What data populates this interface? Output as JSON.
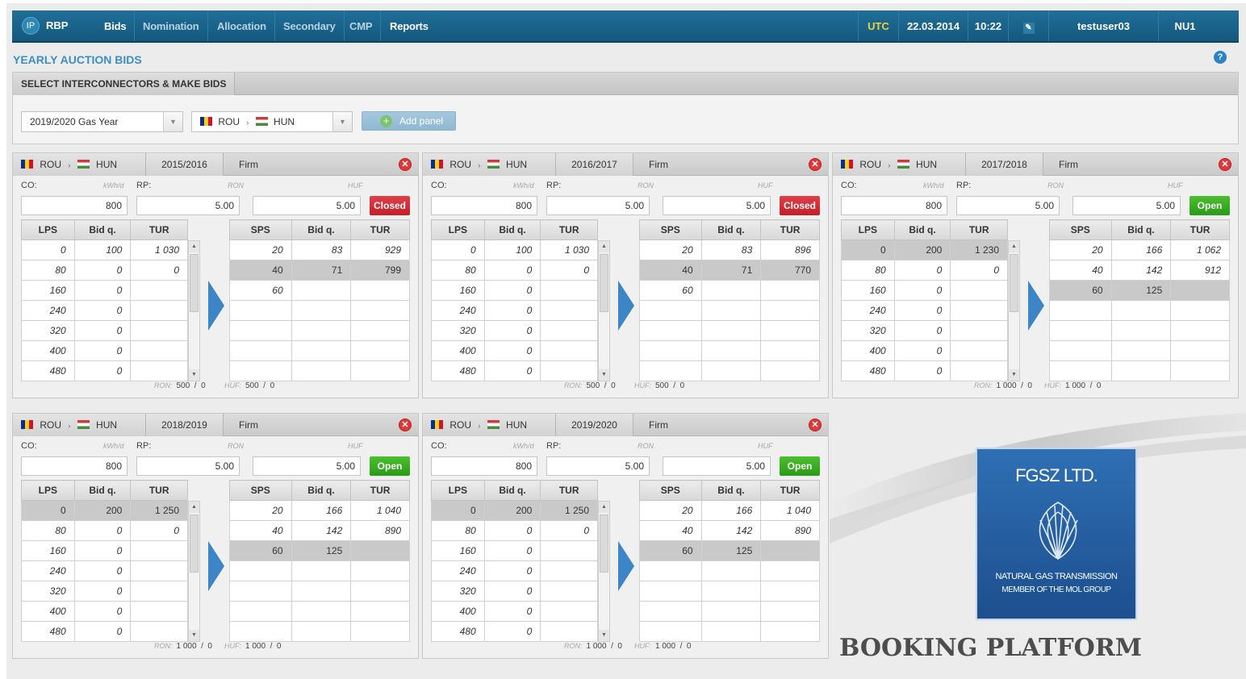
{
  "topbar": {
    "ip": "IP",
    "app": "RBP",
    "nav": [
      "Bids",
      "Nomination",
      "Allocation",
      "Secondary",
      "CMP",
      "Reports"
    ],
    "utc": "UTC",
    "date": "22.03.2014",
    "time": "10:22",
    "user": "testuser03",
    "role": "NU1"
  },
  "page": {
    "title": "YEARLY AUCTION BIDS",
    "help": "?"
  },
  "select": {
    "header": "SELECT INTERCONNECTORS & MAKE BIDS",
    "year": "2019/2020 Gas Year",
    "from": "ROU",
    "to": "HUN",
    "add": "Add panel"
  },
  "panels": [
    {
      "from": "ROU",
      "to": "HUN",
      "year": "2015/2016",
      "type": "Firm",
      "co_label": "CO:",
      "co_unit": "kWh/d",
      "rp_label": "RP:",
      "rp_unit": "RON",
      "huf_unit": "HUF",
      "co": "800",
      "rp": "5.00",
      "huf": "5.00",
      "status": "Closed",
      "lps_head": [
        "LPS",
        "Bid q.",
        "TUR"
      ],
      "lps": [
        [
          "0",
          "100",
          "1 030"
        ],
        [
          "80",
          "0",
          "0"
        ],
        [
          "160",
          "0",
          ""
        ],
        [
          "240",
          "0",
          ""
        ],
        [
          "320",
          "0",
          ""
        ],
        [
          "400",
          "0",
          ""
        ],
        [
          "480",
          "0",
          ""
        ]
      ],
      "sps_head": [
        "SPS",
        "Bid q.",
        "TUR"
      ],
      "sps": [
        [
          "20",
          "83",
          "929"
        ],
        [
          "40",
          "71",
          "799"
        ],
        [
          "60",
          "",
          ""
        ],
        [
          "",
          "",
          ""
        ],
        [
          "",
          "",
          ""
        ],
        [
          "",
          "",
          ""
        ],
        [
          "",
          "",
          ""
        ]
      ],
      "ron_label": "RON:",
      "ron": "500  /  0",
      "hufl": "HUF:",
      "huf_total": "500  /  0"
    },
    {
      "from": "ROU",
      "to": "HUN",
      "year": "2016/2017",
      "type": "Firm",
      "co_label": "CO:",
      "co_unit": "kWh/d",
      "rp_label": "RP:",
      "rp_unit": "RON",
      "huf_unit": "HUF",
      "co": "800",
      "rp": "5.00",
      "huf": "5.00",
      "status": "Closed",
      "lps_head": [
        "LPS",
        "Bid q.",
        "TUR"
      ],
      "lps": [
        [
          "0",
          "100",
          "1 030"
        ],
        [
          "80",
          "0",
          "0"
        ],
        [
          "160",
          "0",
          ""
        ],
        [
          "240",
          "0",
          ""
        ],
        [
          "320",
          "0",
          ""
        ],
        [
          "400",
          "0",
          ""
        ],
        [
          "480",
          "0",
          ""
        ]
      ],
      "sps_head": [
        "SPS",
        "Bid q.",
        "TUR"
      ],
      "sps": [
        [
          "20",
          "83",
          "896"
        ],
        [
          "40",
          "71",
          "770"
        ],
        [
          "60",
          "",
          ""
        ],
        [
          "",
          "",
          ""
        ],
        [
          "",
          "",
          ""
        ],
        [
          "",
          "",
          ""
        ],
        [
          "",
          "",
          ""
        ]
      ],
      "ron_label": "RON:",
      "ron": "500  /  0",
      "hufl": "HUF:",
      "huf_total": "500  /  0"
    },
    {
      "from": "ROU",
      "to": "HUN",
      "year": "2017/2018",
      "type": "Firm",
      "co_label": "CO:",
      "co_unit": "kWh/d",
      "rp_label": "RP:",
      "rp_unit": "RON",
      "huf_unit": "HUF",
      "co": "800",
      "rp": "5.00",
      "huf": "5.00",
      "status": "Open",
      "lps_head": [
        "LPS",
        "Bid q.",
        "TUR"
      ],
      "lps": [
        [
          "0",
          "200",
          "1 230"
        ],
        [
          "80",
          "0",
          "0"
        ],
        [
          "160",
          "0",
          ""
        ],
        [
          "240",
          "0",
          ""
        ],
        [
          "320",
          "0",
          ""
        ],
        [
          "400",
          "0",
          ""
        ],
        [
          "480",
          "0",
          ""
        ]
      ],
      "sps_head": [
        "SPS",
        "Bid q.",
        "TUR"
      ],
      "sps": [
        [
          "20",
          "166",
          "1 062"
        ],
        [
          "40",
          "142",
          "912"
        ],
        [
          "60",
          "125",
          ""
        ],
        [
          "",
          "",
          ""
        ],
        [
          "",
          "",
          ""
        ],
        [
          "",
          "",
          ""
        ],
        [
          "",
          "",
          ""
        ]
      ],
      "ron_label": "RON:",
      "ron": "1 000  /  0",
      "hufl": "HUF:",
      "huf_total": "1 000  /  0"
    },
    {
      "from": "ROU",
      "to": "HUN",
      "year": "2018/2019",
      "type": "Firm",
      "co_label": "CO:",
      "co_unit": "kWh/d",
      "rp_label": "RP:",
      "rp_unit": "RON",
      "huf_unit": "HUF",
      "co": "800",
      "rp": "5.00",
      "huf": "5.00",
      "status": "Open",
      "lps_head": [
        "LPS",
        "Bid q.",
        "TUR"
      ],
      "lps": [
        [
          "0",
          "200",
          "1 250"
        ],
        [
          "80",
          "0",
          "0"
        ],
        [
          "160",
          "0",
          ""
        ],
        [
          "240",
          "0",
          ""
        ],
        [
          "320",
          "0",
          ""
        ],
        [
          "400",
          "0",
          ""
        ],
        [
          "480",
          "0",
          ""
        ]
      ],
      "sps_head": [
        "SPS",
        "Bid q.",
        "TUR"
      ],
      "sps": [
        [
          "20",
          "166",
          "1 040"
        ],
        [
          "40",
          "142",
          "890"
        ],
        [
          "60",
          "125",
          ""
        ],
        [
          "",
          "",
          ""
        ],
        [
          "",
          "",
          ""
        ],
        [
          "",
          "",
          ""
        ],
        [
          "",
          "",
          ""
        ]
      ],
      "ron_label": "RON:",
      "ron": "1 000  /  0",
      "hufl": "HUF:",
      "huf_total": "1 000  /  0"
    },
    {
      "from": "ROU",
      "to": "HUN",
      "year": "2019/2020",
      "type": "Firm",
      "co_label": "CO:",
      "co_unit": "kWh/d",
      "rp_label": "RP:",
      "rp_unit": "RON",
      "huf_unit": "HUF",
      "co": "800",
      "rp": "5.00",
      "huf": "5.00",
      "status": "Open",
      "lps_head": [
        "LPS",
        "Bid q.",
        "TUR"
      ],
      "lps": [
        [
          "0",
          "200",
          "1 250"
        ],
        [
          "80",
          "0",
          "0"
        ],
        [
          "160",
          "0",
          ""
        ],
        [
          "240",
          "0",
          ""
        ],
        [
          "320",
          "0",
          ""
        ],
        [
          "400",
          "0",
          ""
        ],
        [
          "480",
          "0",
          ""
        ]
      ],
      "sps_head": [
        "SPS",
        "Bid q.",
        "TUR"
      ],
      "sps": [
        [
          "20",
          "166",
          "1 040"
        ],
        [
          "40",
          "142",
          "890"
        ],
        [
          "60",
          "125",
          ""
        ],
        [
          "",
          "",
          ""
        ],
        [
          "",
          "",
          ""
        ],
        [
          "",
          "",
          ""
        ],
        [
          "",
          "",
          ""
        ]
      ],
      "ron_label": "RON:",
      "ron": "1 000  /  0",
      "hufl": "HUF:",
      "huf_total": "1 000  /  0"
    }
  ],
  "logo": {
    "name": "FGSZ LTD.",
    "line1": "NATURAL GAS TRANSMISSION",
    "line2": "MEMBER OF THE MOL GROUP",
    "platform": "BOOKING PLATFORM"
  },
  "colors": {
    "topbar": "#15587d",
    "closed": "#c41e28",
    "open": "#2b9a18",
    "accent": "#3a8fc6"
  }
}
